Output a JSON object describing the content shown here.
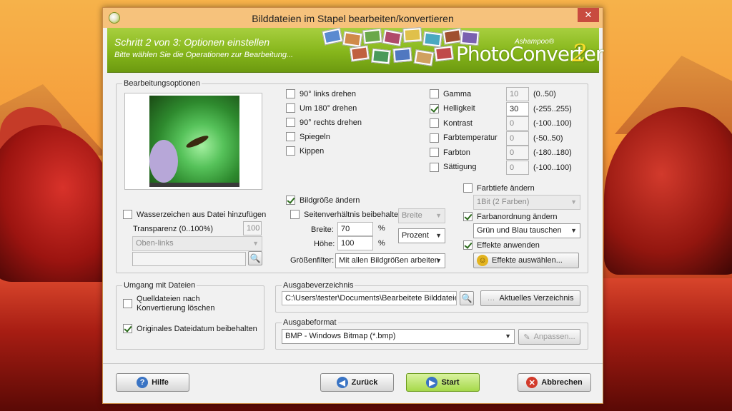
{
  "window": {
    "title": "Bilddateien im Stapel bearbeiten/konvertieren",
    "close": "✕"
  },
  "banner": {
    "step": "Schritt 2 von 3: Optionen einstellen",
    "subtitle": "Bitte wählen Sie die Operationen zur Bearbeitung...",
    "brand": "Ashampoo®",
    "product": "PhotoConverter",
    "version": "2"
  },
  "edit": {
    "group_label": "Bearbeitungsoptionen",
    "rotate": [
      {
        "label": "90° links drehen",
        "checked": false
      },
      {
        "label": "Um 180° drehen",
        "checked": false
      },
      {
        "label": "90° rechts drehen",
        "checked": false
      },
      {
        "label": "Spiegeln",
        "checked": false
      },
      {
        "label": "Kippen",
        "checked": false
      }
    ],
    "adjust": [
      {
        "label": "Gamma",
        "checked": false,
        "value": "10",
        "range": "(0..50)"
      },
      {
        "label": "Helligkeit",
        "checked": true,
        "value": "30",
        "range": "(-255..255)"
      },
      {
        "label": "Kontrast",
        "checked": false,
        "value": "0",
        "range": "(-100..100)"
      },
      {
        "label": "Farbtemperatur",
        "checked": false,
        "value": "0",
        "range": "(-50..50)"
      },
      {
        "label": "Farbton",
        "checked": false,
        "value": "0",
        "range": "(-180..180)"
      },
      {
        "label": "Sättigung",
        "checked": false,
        "value": "0",
        "range": "(-100..100)"
      }
    ],
    "watermark": {
      "label": "Wasserzeichen aus Datei hinzufügen",
      "checked": false,
      "transparency_label": "Transparenz (0..100%)",
      "transparency_value": "100",
      "position": "Oben-links",
      "file": ""
    },
    "resize": {
      "label": "Bildgröße ändern",
      "checked": true,
      "keep_ratio_label": "Seitenverhältnis beibehalten",
      "keep_ratio_checked": false,
      "ratio_select": "Breite",
      "width_label": "Breite:",
      "width_value": "70",
      "height_label": "Höhe:",
      "height_value": "100",
      "unit_width": "%",
      "unit_height": "%",
      "unit_select": "Prozent",
      "filter_label": "Größenfilter:",
      "filter_value": "Mit allen Bildgrößen arbeiten"
    },
    "depth": {
      "label": "Farbtiefe ändern",
      "checked": false,
      "value": "1Bit (2 Farben)"
    },
    "order": {
      "label": "Farbanordnung ändern",
      "checked": true,
      "value": "Grün und Blau tauschen"
    },
    "effects": {
      "label": "Effekte anwenden",
      "checked": true,
      "button": "Effekte auswählen..."
    }
  },
  "files": {
    "group_label": "Umgang mit Dateien",
    "delete_label": "Quelldateien nach Konvertierung löschen",
    "delete_checked": false,
    "keep_date_label": "Originales Dateidatum beibehalten",
    "keep_date_checked": true
  },
  "output_dir": {
    "group_label": "Ausgabeverzeichnis",
    "path": "C:\\Users\\tester\\Documents\\Bearbeitete Bilddateien",
    "current_button": "Aktuelles Verzeichnis"
  },
  "output_format": {
    "group_label": "Ausgabeformat",
    "value": "BMP - Windows Bitmap (*.bmp)",
    "adjust_button": "Anpassen..."
  },
  "footer": {
    "help": "Hilfe",
    "back": "Zurück",
    "start": "Start",
    "cancel": "Abbrechen"
  },
  "colors": {
    "banner": "#86b61b",
    "titlebar": "#f6c27c",
    "close": "#c84b3f",
    "start": "#a6d94a"
  }
}
